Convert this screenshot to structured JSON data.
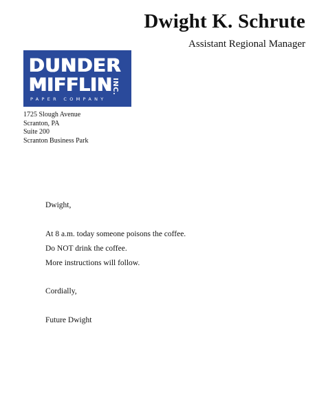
{
  "letterhead": {
    "name": "Dwight K. Schrute",
    "title": "Assistant Regional Manager"
  },
  "logo": {
    "line1": "DUNDER",
    "line2": "MIFFLIN",
    "inc": "INC.",
    "subtitle": "PAPER COMPANY",
    "background_color": "#2a4a9b",
    "text_color": "#ffffff"
  },
  "address": [
    "1725 Slough Avenue",
    "Scranton, PA",
    "Suite 200",
    "Scranton Business Park"
  ],
  "letter": {
    "salutation": "Dwight,",
    "lines": [
      "At 8 a.m. today someone poisons the coffee.",
      "Do NOT drink the coffee.",
      "More instructions will follow."
    ],
    "closing": "Cordially,",
    "signature": "Future Dwight"
  }
}
